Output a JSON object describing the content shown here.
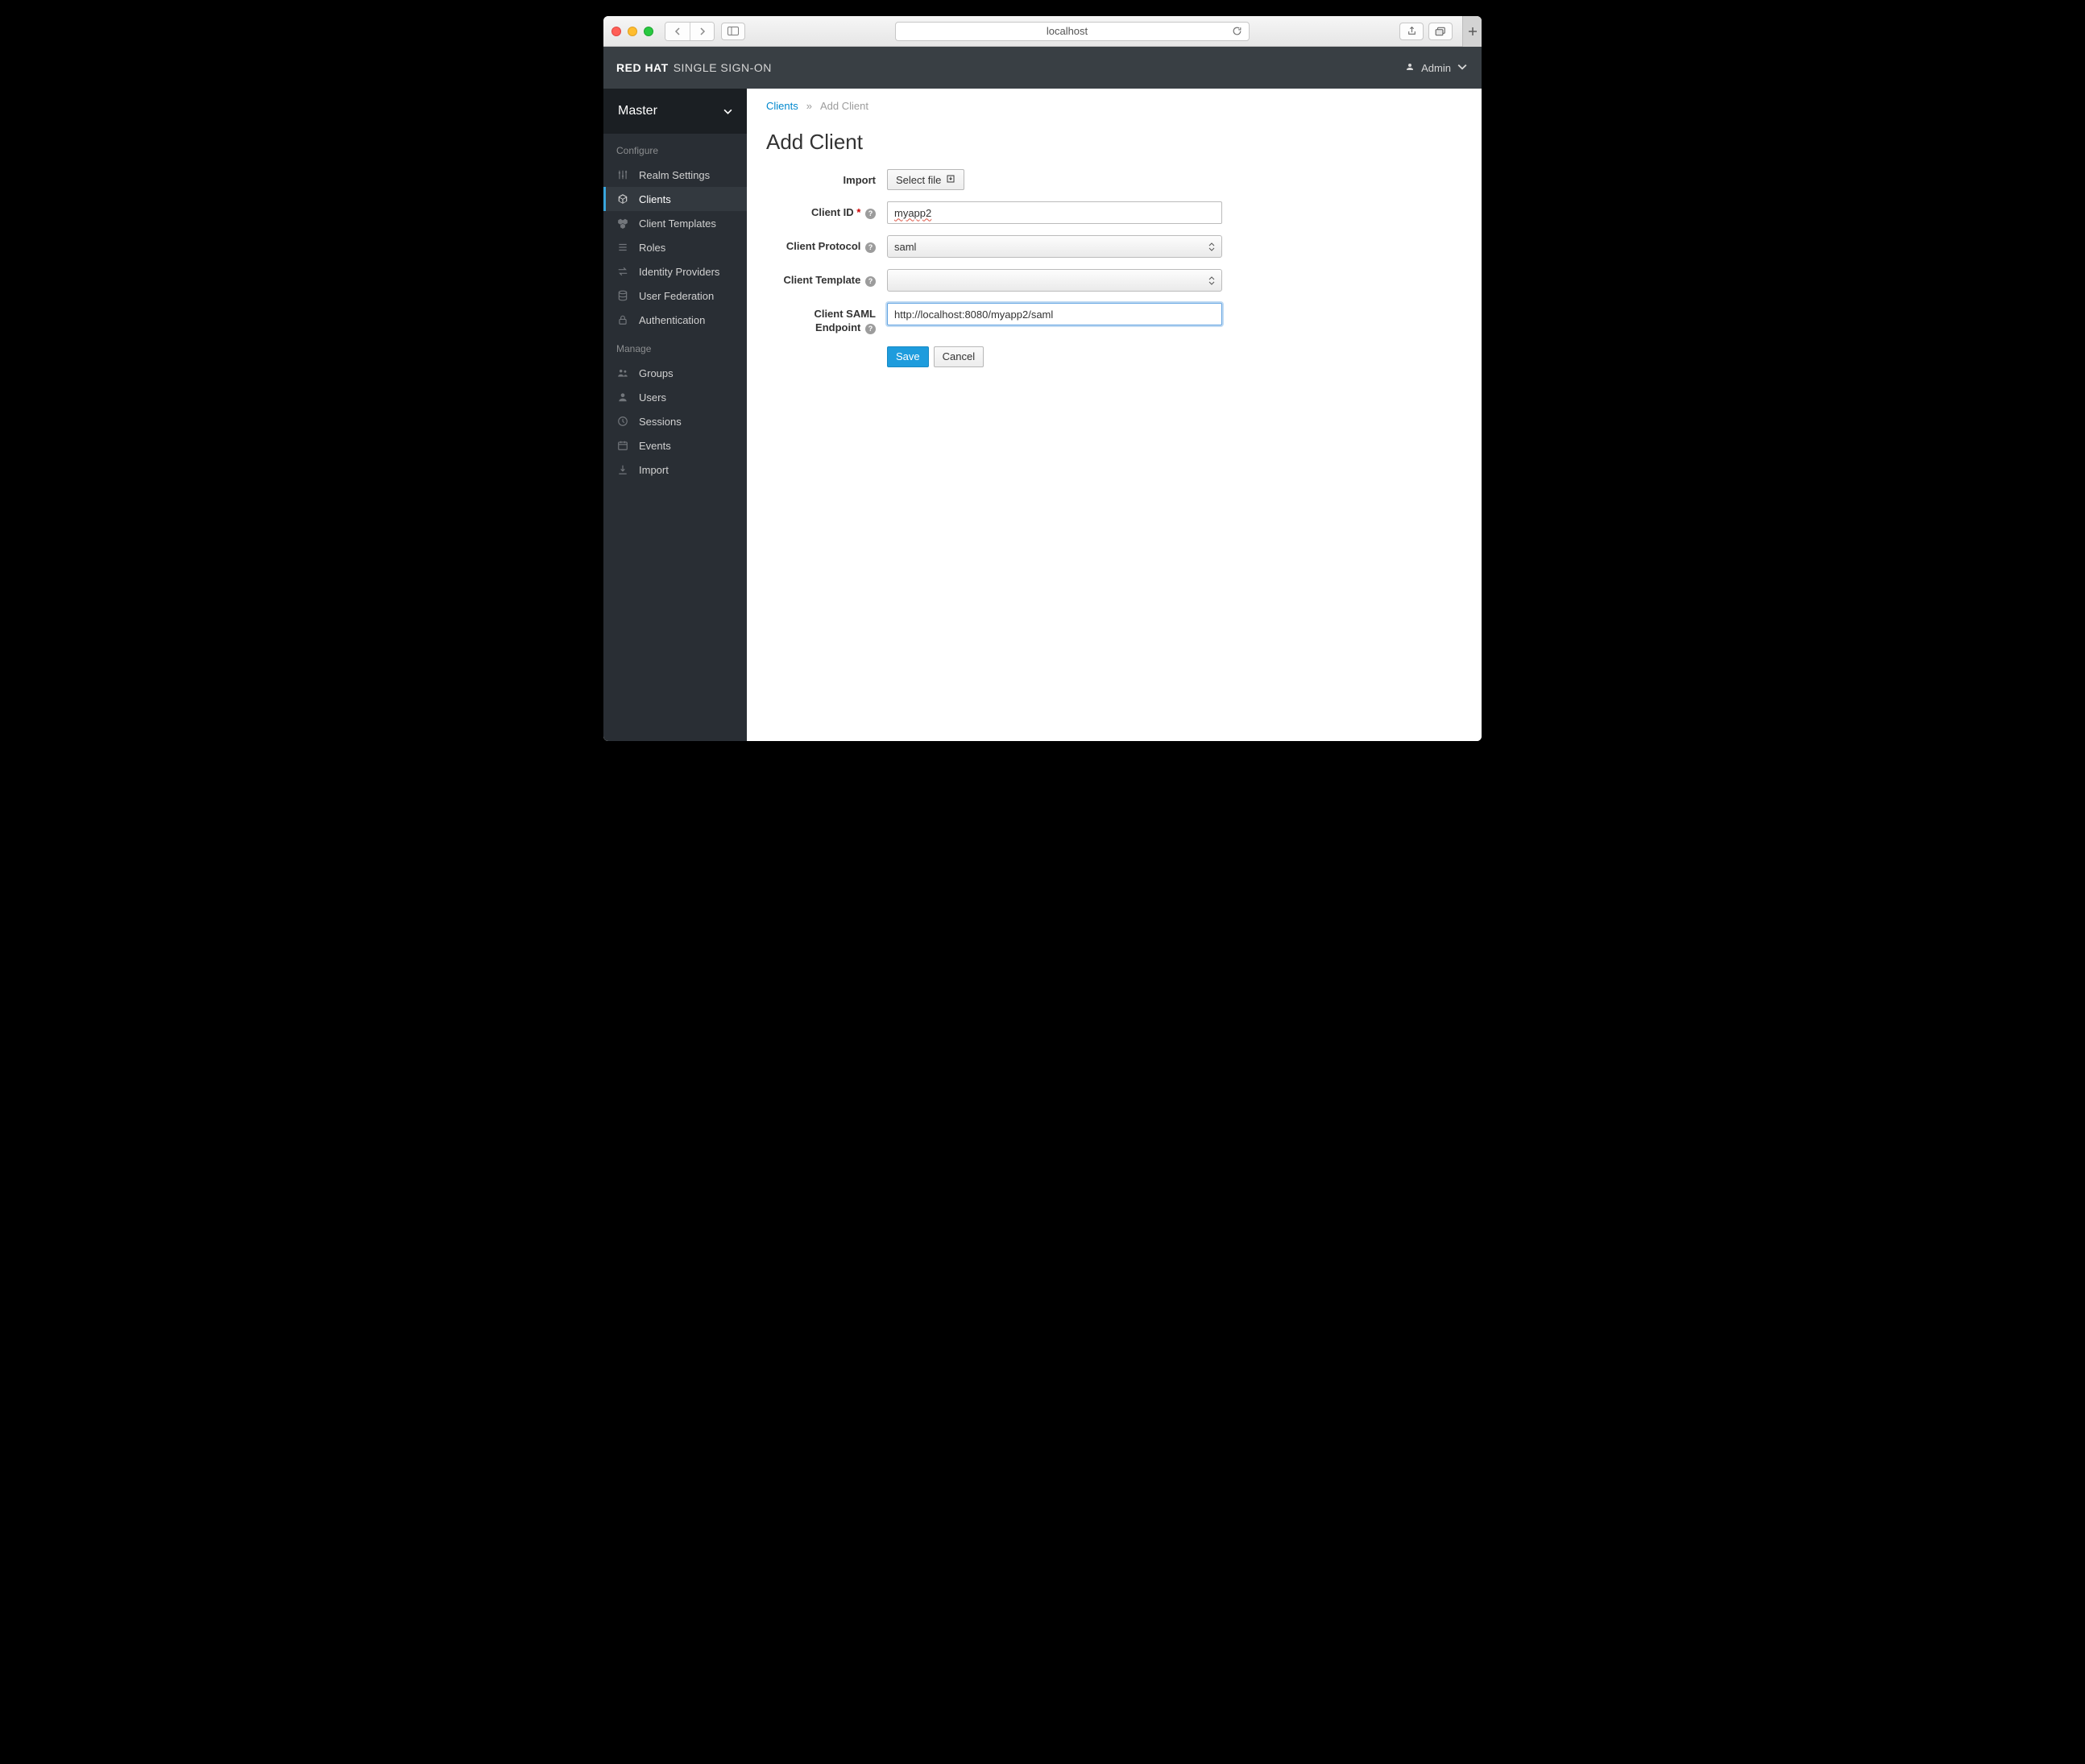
{
  "browser": {
    "address": "localhost"
  },
  "header": {
    "brand_strong": "RED HAT",
    "brand_light": "SINGLE SIGN-ON",
    "user_label": "Admin"
  },
  "sidebar": {
    "realm": "Master",
    "sections": {
      "configure_label": "Configure",
      "manage_label": "Manage"
    },
    "configure": [
      {
        "label": "Realm Settings"
      },
      {
        "label": "Clients"
      },
      {
        "label": "Client Templates"
      },
      {
        "label": "Roles"
      },
      {
        "label": "Identity Providers"
      },
      {
        "label": "User Federation"
      },
      {
        "label": "Authentication"
      }
    ],
    "manage": [
      {
        "label": "Groups"
      },
      {
        "label": "Users"
      },
      {
        "label": "Sessions"
      },
      {
        "label": "Events"
      },
      {
        "label": "Import"
      }
    ]
  },
  "breadcrumb": {
    "root": "Clients",
    "current": "Add Client"
  },
  "page": {
    "title": "Add Client"
  },
  "form": {
    "import_label": "Import",
    "import_button": "Select file",
    "client_id_label": "Client ID",
    "client_id_value": "myapp2",
    "protocol_label": "Client Protocol",
    "protocol_value": "saml",
    "template_label": "Client Template",
    "template_value": "",
    "endpoint_label": "Client SAML Endpoint",
    "endpoint_value": "http://localhost:8080/myapp2/saml",
    "save": "Save",
    "cancel": "Cancel"
  }
}
